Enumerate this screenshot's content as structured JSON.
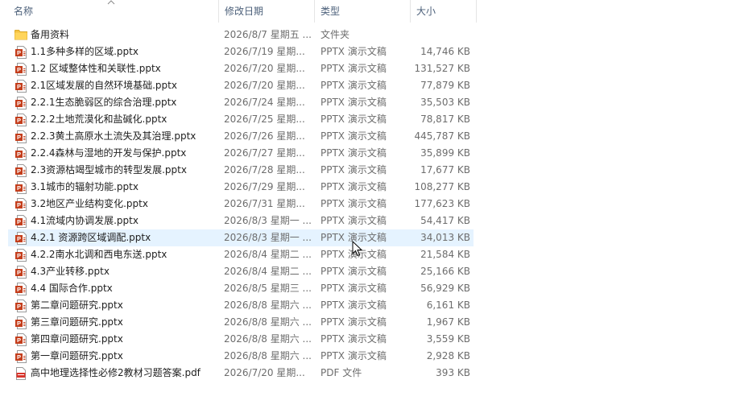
{
  "columns": {
    "name": "名称",
    "date": "修改日期",
    "type": "类型",
    "size": "大小"
  },
  "colors": {
    "header_text": "#4c607a",
    "hover_row": "#e5f3ff",
    "pptx_icon": "#c43e1c",
    "pdf_icon": "#d9342b",
    "folder_icon": "#f5c342"
  },
  "files": [
    {
      "name": "备用资料",
      "date": "2026/8/7 星期五 ...",
      "type": "文件夹",
      "size": "",
      "icon": "folder-icon"
    },
    {
      "name": "1.1多种多样的区域.pptx",
      "date": "2026/7/19 星期...",
      "type": "PPTX 演示文稿",
      "size": "14,746 KB",
      "icon": "pptx-file-icon"
    },
    {
      "name": "1.2 区域整体性和关联性.pptx",
      "date": "2026/7/20 星期...",
      "type": "PPTX 演示文稿",
      "size": "131,527 KB",
      "icon": "pptx-file-icon"
    },
    {
      "name": "2.1区域发展的自然环境基础.pptx",
      "date": "2026/7/20 星期...",
      "type": "PPTX 演示文稿",
      "size": "77,879 KB",
      "icon": "pptx-file-icon"
    },
    {
      "name": "2.2.1生态脆弱区的综合治理.pptx",
      "date": "2026/7/24 星期...",
      "type": "PPTX 演示文稿",
      "size": "35,503 KB",
      "icon": "pptx-file-icon"
    },
    {
      "name": "2.2.2土地荒漠化和盐碱化.pptx",
      "date": "2026/7/25 星期...",
      "type": "PPTX 演示文稿",
      "size": "78,817 KB",
      "icon": "pptx-file-icon"
    },
    {
      "name": "2.2.3黄土高原水土流失及其治理.pptx",
      "date": "2026/7/26 星期...",
      "type": "PPTX 演示文稿",
      "size": "445,787 KB",
      "icon": "pptx-file-icon"
    },
    {
      "name": "2.2.4森林与湿地的开发与保护.pptx",
      "date": "2026/7/27 星期...",
      "type": "PPTX 演示文稿",
      "size": "35,899 KB",
      "icon": "pptx-file-icon"
    },
    {
      "name": "2.3资源枯竭型城市的转型发展.pptx",
      "date": "2026/7/28 星期...",
      "type": "PPTX 演示文稿",
      "size": "17,677 KB",
      "icon": "pptx-file-icon"
    },
    {
      "name": "3.1城市的辐射功能.pptx",
      "date": "2026/7/29 星期...",
      "type": "PPTX 演示文稿",
      "size": "108,277 KB",
      "icon": "pptx-file-icon"
    },
    {
      "name": "3.2地区产业结构变化.pptx",
      "date": "2026/7/31 星期...",
      "type": "PPTX 演示文稿",
      "size": "177,623 KB",
      "icon": "pptx-file-icon"
    },
    {
      "name": "4.1流域内协调发展.pptx",
      "date": "2026/8/3 星期一 ...",
      "type": "PPTX 演示文稿",
      "size": "54,417 KB",
      "icon": "pptx-file-icon"
    },
    {
      "name": "4.2.1 资源跨区域调配.pptx",
      "date": "2026/8/3 星期一 ...",
      "type": "PPTX 演示文稿",
      "size": "34,013 KB",
      "icon": "pptx-file-icon",
      "hover": true
    },
    {
      "name": "4.2.2南水北调和西电东送.pptx",
      "date": "2026/8/4 星期二 ...",
      "type": "PPTX 演示文稿",
      "size": "21,584 KB",
      "icon": "pptx-file-icon"
    },
    {
      "name": "4.3产业转移.pptx",
      "date": "2026/8/4 星期二 ...",
      "type": "PPTX 演示文稿",
      "size": "25,166 KB",
      "icon": "pptx-file-icon"
    },
    {
      "name": "4.4 国际合作.pptx",
      "date": "2026/8/5 星期三 ...",
      "type": "PPTX 演示文稿",
      "size": "56,929 KB",
      "icon": "pptx-file-icon"
    },
    {
      "name": "第二章问题研究.pptx",
      "date": "2026/8/8 星期六 ...",
      "type": "PPTX 演示文稿",
      "size": "6,161 KB",
      "icon": "pptx-file-icon"
    },
    {
      "name": "第三章问题研究.pptx",
      "date": "2026/8/8 星期六 ...",
      "type": "PPTX 演示文稿",
      "size": "1,967 KB",
      "icon": "pptx-file-icon"
    },
    {
      "name": "第四章问题研究.pptx",
      "date": "2026/8/8 星期六 ...",
      "type": "PPTX 演示文稿",
      "size": "3,559 KB",
      "icon": "pptx-file-icon"
    },
    {
      "name": "第一章问题研究.pptx",
      "date": "2026/8/8 星期六 ...",
      "type": "PPTX 演示文稿",
      "size": "2,928 KB",
      "icon": "pptx-file-icon"
    },
    {
      "name": "高中地理选择性必修2教材习题答案.pdf",
      "date": "2026/7/20 星期...",
      "type": "PDF 文件",
      "size": "393 KB",
      "icon": "pdf-file-icon"
    }
  ]
}
